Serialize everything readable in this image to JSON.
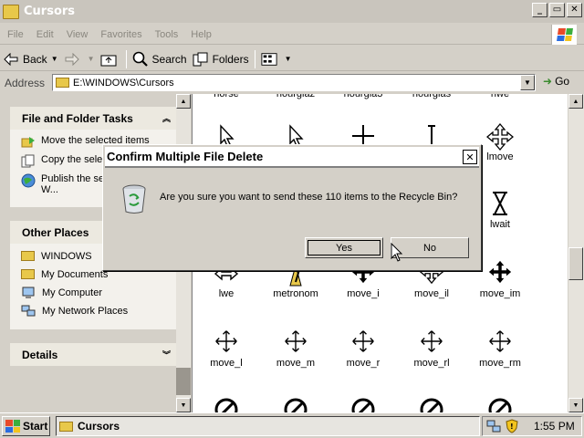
{
  "window": {
    "title": "Cursors",
    "controls": [
      "_",
      "▭",
      "✕"
    ]
  },
  "menu": [
    "File",
    "Edit",
    "View",
    "Favorites",
    "Tools",
    "Help"
  ],
  "toolbar": {
    "back": "Back",
    "search": "Search",
    "folders": "Folders"
  },
  "address": {
    "label": "Address",
    "value": "E:\\WINDOWS\\Cursors",
    "go": "Go"
  },
  "tasks": {
    "title": "File and Folder Tasks",
    "items": [
      {
        "label": "Move the selected items"
      },
      {
        "label": "Copy the sele..."
      },
      {
        "label": "Publish the se... items to the W..."
      }
    ]
  },
  "places": {
    "title": "Other Places",
    "items": [
      "WINDOWS",
      "My Documents",
      "My Computer",
      "My Network Places"
    ]
  },
  "details": {
    "title": "Details"
  },
  "files": {
    "row0": [
      "horse",
      "hourglaz",
      "hourgla3",
      "hourglas",
      "hwe"
    ],
    "row1_right": [
      "lmove",
      "lwait"
    ],
    "row2": [
      "lwe",
      "metronom",
      "move_i",
      "move_il",
      "move_im"
    ],
    "row3": [
      "move_l",
      "move_m",
      "move_r",
      "move_rl",
      "move_rm"
    ]
  },
  "dialog": {
    "title": "Confirm Multiple File Delete",
    "message": "Are you sure you want to send these 110 items to the Recycle Bin?",
    "yes": "Yes",
    "no": "No"
  },
  "taskbar": {
    "start": "Start",
    "task": "Cursors",
    "clock": "1:55 PM"
  }
}
